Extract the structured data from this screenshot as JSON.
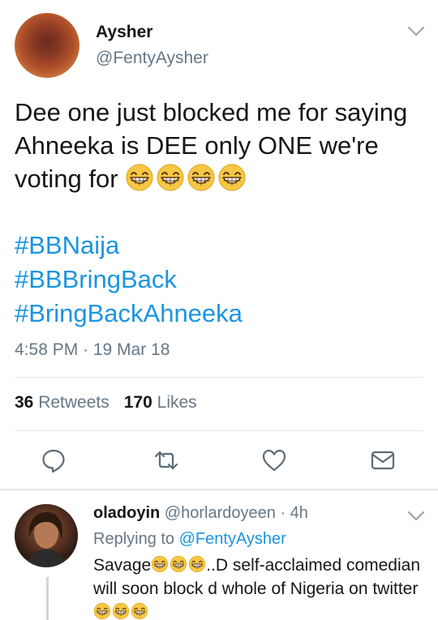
{
  "tweet": {
    "author": {
      "display_name": "Aysher",
      "handle": "@FentyAysher"
    },
    "text": "Dee one just blocked me for saying Ahneeka is DEE only ONE we're voting for",
    "emoji_count": 4,
    "hashtags": [
      "#BBNaija",
      "#BBBringBack",
      "#BringBackAhneeka"
    ],
    "timestamp": "4:58 PM · 19 Mar 18",
    "retweets_count": "36",
    "retweets_label": "Retweets",
    "likes_count": "170",
    "likes_label": "Likes"
  },
  "actions": [
    "reply-icon",
    "retweet-icon",
    "like-icon",
    "direct-message-icon"
  ],
  "reply": {
    "display_name": "oladoyin",
    "handle": "@horlardoyeen",
    "time": "· 4h",
    "replying_prefix": "Replying to",
    "replying_to": "@FentyAysher",
    "text_part1": "Savage",
    "text_part2": "..D self-acclaimed comedian will soon block d whole of Nigeria on twitter"
  },
  "colors": {
    "link_blue": "#1b95e0",
    "text_dark": "#14171a",
    "text_gray": "#657786",
    "divider": "#e1e8ed"
  }
}
